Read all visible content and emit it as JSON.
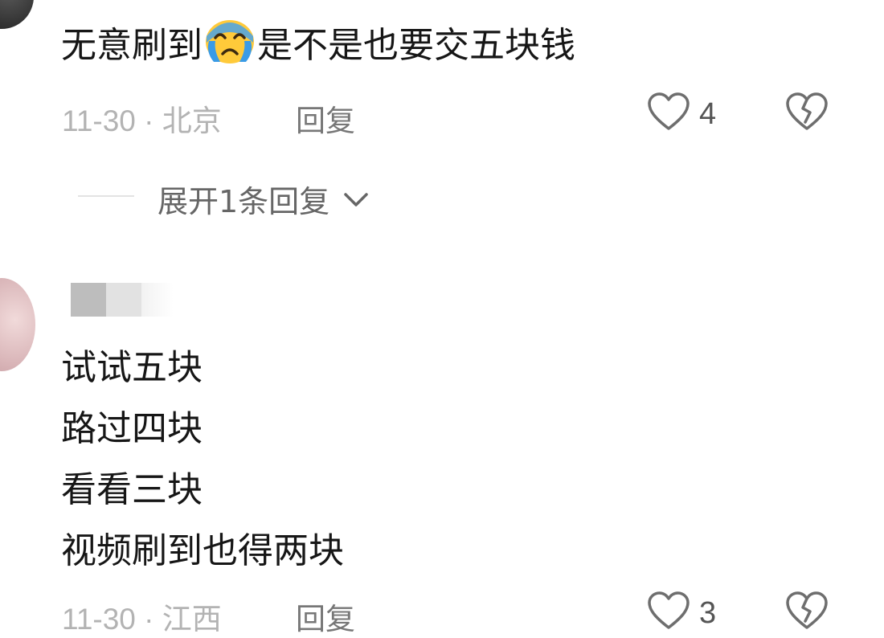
{
  "comments": [
    {
      "text_before_emoji": "无意刷到",
      "emoji": "crying-face-emoji",
      "text_after_emoji": "是不是也要交五块钱",
      "date": "11-30",
      "separator": "·",
      "location": "北京",
      "reply_label": "回复",
      "likes": "4"
    },
    {
      "lines": [
        "试试五块",
        "路过四块",
        "看看三块",
        "视频刷到也得两块"
      ],
      "date": "11-30",
      "separator": "·",
      "location": "江西",
      "reply_label": "回复",
      "likes": "3"
    }
  ],
  "expand_replies": {
    "label": "展开1条回复"
  },
  "colors": {
    "text": "#161616",
    "meta": "#b3b3b3",
    "icon": "#6e6e6e"
  }
}
